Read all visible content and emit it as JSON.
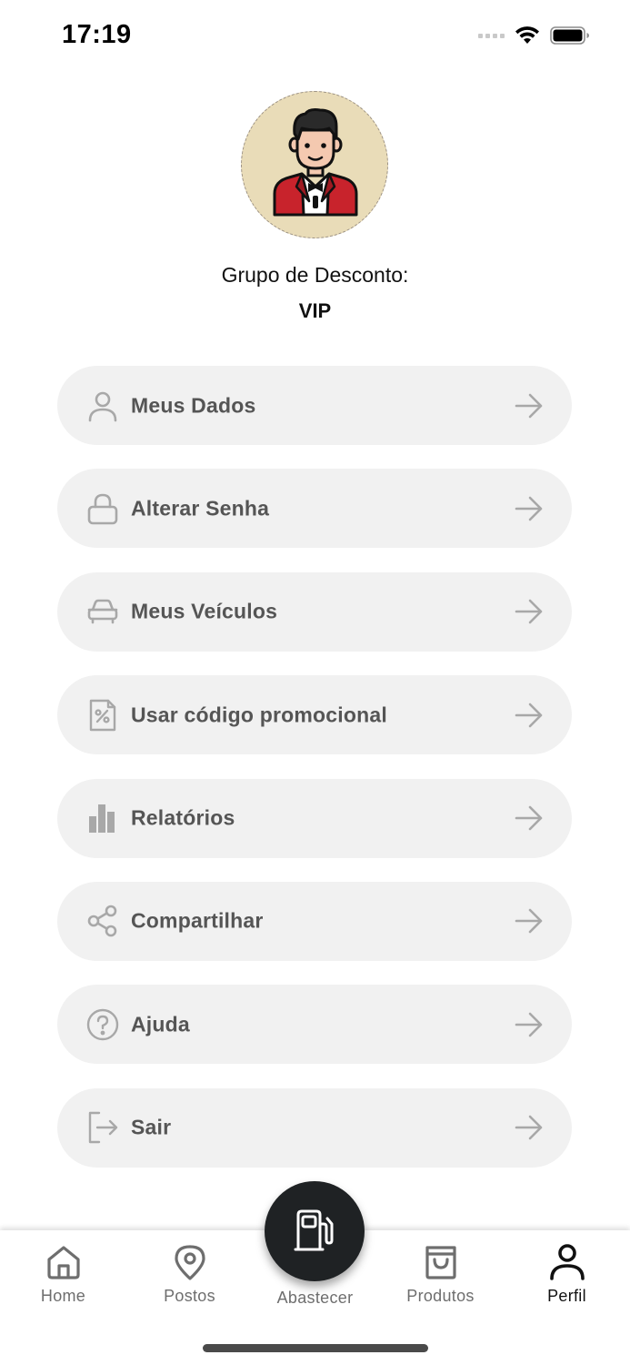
{
  "status_bar": {
    "time": "17:19",
    "icons": [
      "cellular-signal-icon",
      "wifi-icon",
      "battery-icon"
    ]
  },
  "profile": {
    "avatar_icon": "businessman-avatar-icon",
    "group_label": "Grupo de Desconto:",
    "group_value": "VIP"
  },
  "menu": {
    "items": [
      {
        "label": "Meus Dados",
        "icon": "user-icon"
      },
      {
        "label": "Alterar Senha",
        "icon": "lock-icon"
      },
      {
        "label": "Meus Veículos",
        "icon": "car-icon"
      },
      {
        "label": "Usar código promocional",
        "icon": "percent-receipt-icon"
      },
      {
        "label": "Relatórios",
        "icon": "bar-chart-icon"
      },
      {
        "label": "Compartilhar",
        "icon": "share-icon"
      },
      {
        "label": "Ajuda",
        "icon": "help-icon"
      },
      {
        "label": "Sair",
        "icon": "logout-icon"
      }
    ],
    "arrow_icon": "arrow-right-icon"
  },
  "bottom_nav": {
    "items": [
      {
        "label": "Home",
        "icon": "home-icon"
      },
      {
        "label": "Postos",
        "icon": "map-pin-icon"
      },
      {
        "label": "Abastecer",
        "icon": "fuel-pump-icon"
      },
      {
        "label": "Produtos",
        "icon": "shopping-bag-icon"
      },
      {
        "label": "Perfil",
        "icon": "profile-icon"
      }
    ],
    "active": "Perfil"
  },
  "colors": {
    "menu_bg": "#f1f1f1",
    "menu_text": "#555555",
    "icon_gray": "#a8a8a8",
    "fab_bg": "#1f2224",
    "avatar_bg": "#e9dcb8"
  }
}
